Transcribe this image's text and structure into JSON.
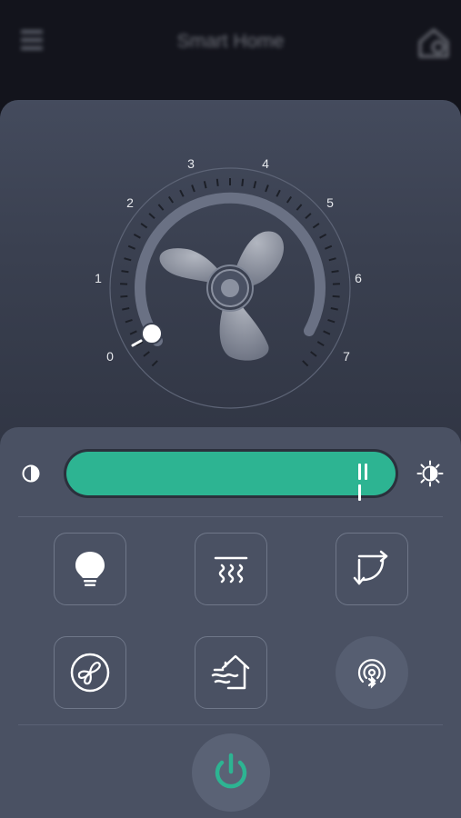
{
  "header": {
    "title": "Smart Home",
    "menu_icon": "menu-icon",
    "home_icon": "home-settings-icon"
  },
  "dial": {
    "ticks": [
      "0",
      "1",
      "2",
      "3",
      "4",
      "5",
      "6",
      "7"
    ],
    "current_speed": 0,
    "fan_icon": "fan-blade-icon"
  },
  "brightness": {
    "low_icon": "contrast-low-icon",
    "high_icon": "sun-icon",
    "level_percent": 100,
    "fill_color": "#2db492"
  },
  "functions": {
    "row1": [
      "light-bulb-icon",
      "heater-icon",
      "swing-rotate-icon"
    ],
    "row2": [
      "fan-mode-icon",
      "home-airflow-icon",
      "bluetooth-speaker-icon"
    ]
  },
  "power": {
    "icon": "power-icon",
    "color": "#2db492"
  },
  "colors": {
    "accent": "#2db492",
    "background": "#13141c",
    "panel": "#4a5163"
  }
}
